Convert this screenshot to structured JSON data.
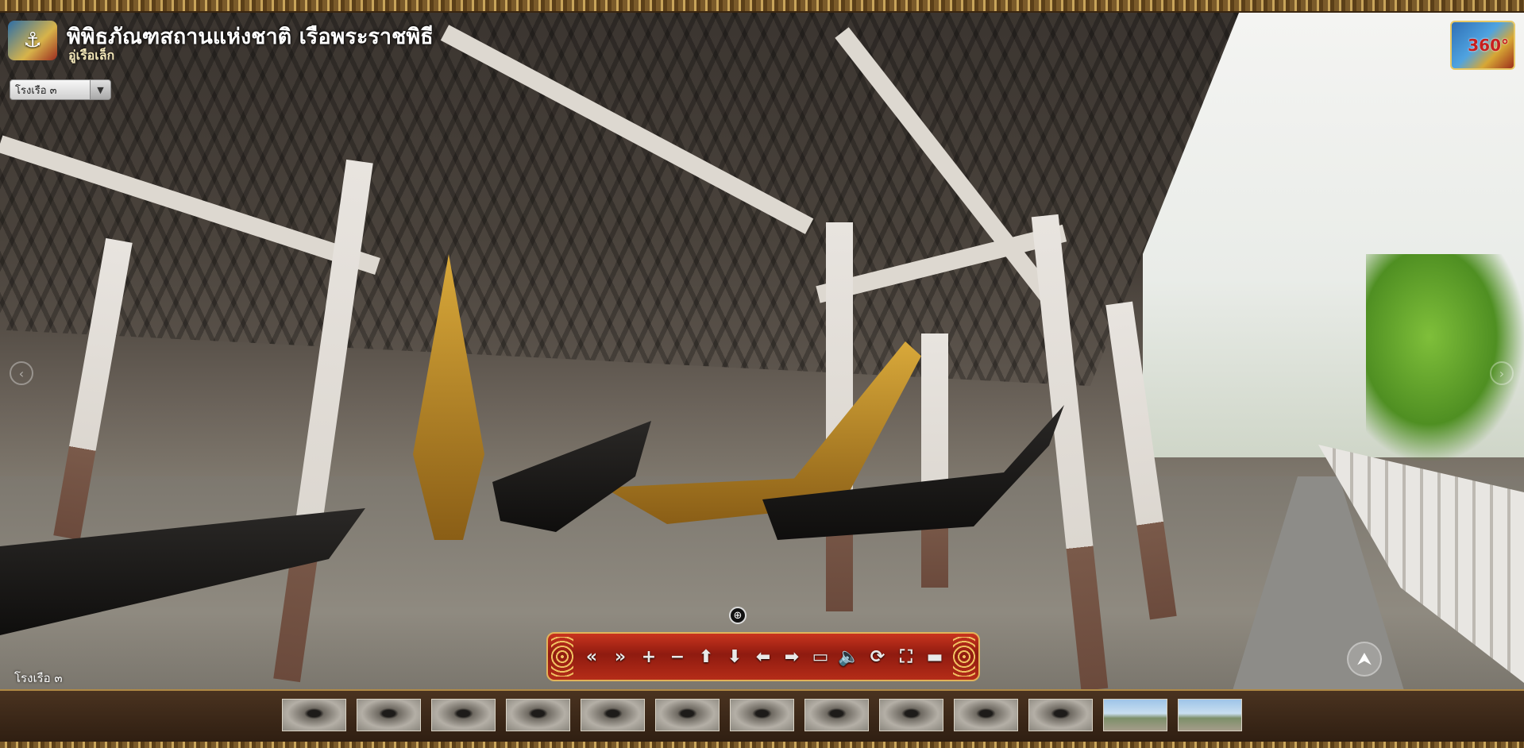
{
  "header": {
    "title": "พิพิธภัณฑสถานแห่งชาติ เรือพระราชพิธี",
    "subtitle": "อู่เรือเล็ก"
  },
  "scene_select": {
    "selected": "โรงเรือ ๓"
  },
  "scene_label": "โรงเรือ ๓",
  "badge": {
    "text": "360°"
  },
  "controls": [
    {
      "name": "rewind-icon",
      "glyph": "«"
    },
    {
      "name": "fast-forward-icon",
      "glyph": "»"
    },
    {
      "name": "zoom-in-icon",
      "glyph": "+"
    },
    {
      "name": "zoom-out-icon",
      "glyph": "−"
    },
    {
      "name": "arrow-up-icon",
      "glyph": "⬆"
    },
    {
      "name": "arrow-down-icon",
      "glyph": "⬇"
    },
    {
      "name": "arrow-left-icon",
      "glyph": "⬅"
    },
    {
      "name": "arrow-right-icon",
      "glyph": "➡"
    },
    {
      "name": "screen-icon",
      "glyph": "▭"
    },
    {
      "name": "sound-icon",
      "glyph": "🔈"
    },
    {
      "name": "auto-rotate-icon",
      "glyph": "⟳"
    },
    {
      "name": "fullscreen-icon",
      "glyph": "⛶"
    },
    {
      "name": "minimize-icon",
      "glyph": "▬"
    }
  ],
  "thumbnails": [
    {
      "kind": "indoor"
    },
    {
      "kind": "indoor"
    },
    {
      "kind": "indoor"
    },
    {
      "kind": "indoor"
    },
    {
      "kind": "indoor"
    },
    {
      "kind": "indoor"
    },
    {
      "kind": "indoor"
    },
    {
      "kind": "indoor"
    },
    {
      "kind": "indoor"
    },
    {
      "kind": "indoor"
    },
    {
      "kind": "indoor"
    },
    {
      "kind": "outdoor"
    },
    {
      "kind": "outdoor"
    }
  ],
  "icons": {
    "left_nav": "‹",
    "right_nav": "›",
    "compass": "⮝",
    "zoom_hint": "⊕",
    "select_arrow": "▼"
  },
  "colors": {
    "control_bar": "#b52c18",
    "gold_trim": "#e2b45a"
  }
}
